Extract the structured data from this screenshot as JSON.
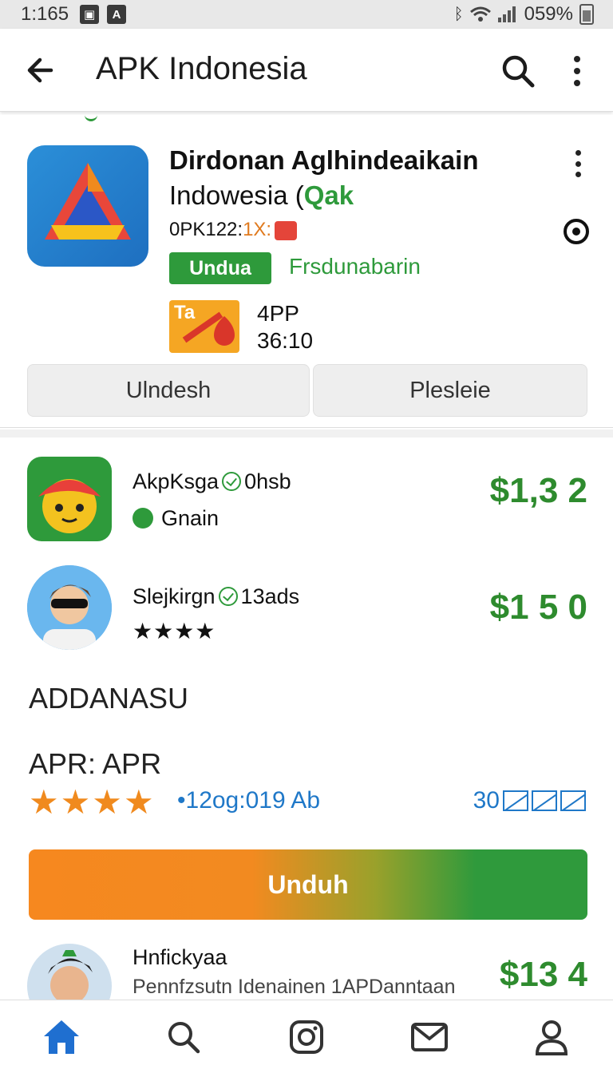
{
  "status_bar": {
    "time": "1:165",
    "battery": "059%"
  },
  "app_bar": {
    "title": "APK Indonesia"
  },
  "featured": {
    "name_line1": "Dirdonan Aglhindeaikain",
    "name_line2": "Indowesia (",
    "name_tag": "Qak",
    "version_prefix": "0PK122:",
    "version_suffix": "1X:",
    "badge_label": "Undua",
    "badge_text": "Frsdunabarin",
    "thumb_text": "Ta",
    "meta_line1": "4PP",
    "meta_line2": "36:10",
    "action_1": "Ulndesh",
    "action_2": "Plesleie"
  },
  "list": [
    {
      "title": "AkpKsga",
      "extra": "0hsb",
      "sub": "Gnain",
      "price": "$1,3 2"
    },
    {
      "title": "Slejkirgn",
      "extra": "13ads",
      "rating": "★★★★",
      "price": "$1 5 0"
    }
  ],
  "section_title": "ADDANASU",
  "apr_label": "APR: APR",
  "rating": {
    "stars": "★★★★",
    "text": "•12og:019 Ab",
    "right": "30"
  },
  "download_label": "Unduh",
  "bottom_row": {
    "title": "Hnfickyaa",
    "sub": "Pennfzsutn Idenainen 1APDanntaan",
    "price": "$13 4"
  },
  "colors": {
    "green": "#2e9a3b",
    "orange": "#f6881f",
    "blue": "#1f78c8"
  }
}
